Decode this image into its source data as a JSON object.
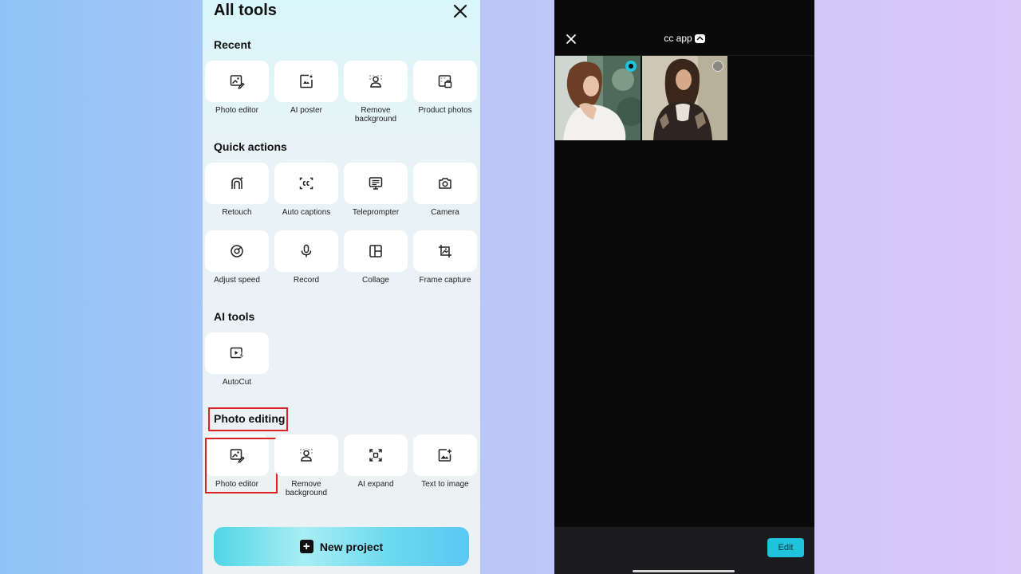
{
  "left_panel": {
    "title": "All tools",
    "sections": {
      "recent": {
        "title": "Recent",
        "tools": [
          {
            "label": "Photo editor",
            "icon": "photo-edit-icon"
          },
          {
            "label": "AI poster",
            "icon": "ai-poster-icon"
          },
          {
            "label": "Remove background",
            "icon": "remove-background-icon"
          },
          {
            "label": "Product photos",
            "icon": "product-photos-icon"
          }
        ]
      },
      "quick_actions": {
        "title": "Quick actions",
        "tools": [
          {
            "label": "Retouch",
            "icon": "retouch-icon"
          },
          {
            "label": "Auto captions",
            "icon": "captions-icon"
          },
          {
            "label": "Teleprompter",
            "icon": "teleprompter-icon"
          },
          {
            "label": "Camera",
            "icon": "camera-icon"
          },
          {
            "label": "Adjust speed",
            "icon": "speed-icon"
          },
          {
            "label": "Record",
            "icon": "microphone-icon"
          },
          {
            "label": "Collage",
            "icon": "collage-icon"
          },
          {
            "label": "Frame capture",
            "icon": "frame-capture-icon"
          }
        ]
      },
      "ai_tools": {
        "title": "AI tools",
        "tools": [
          {
            "label": "AutoCut",
            "icon": "autocut-icon"
          }
        ]
      },
      "photo_editing": {
        "title": "Photo editing",
        "tools": [
          {
            "label": "Photo editor",
            "icon": "photo-edit-icon"
          },
          {
            "label": "Remove background",
            "icon": "remove-background-icon"
          },
          {
            "label": "AI expand",
            "icon": "ai-expand-icon"
          },
          {
            "label": "Text to image",
            "icon": "text-to-image-icon"
          }
        ]
      }
    },
    "new_project_label": "New project"
  },
  "right_panel": {
    "album_name": "cc app",
    "edit_label": "Edit",
    "photos": [
      {
        "selected": true
      },
      {
        "selected": false
      }
    ]
  },
  "colors": {
    "accent": "#1fc3dc",
    "highlight": "#e02020",
    "background_left": "#8fc3f7",
    "background_right": "#dcc7f9"
  }
}
